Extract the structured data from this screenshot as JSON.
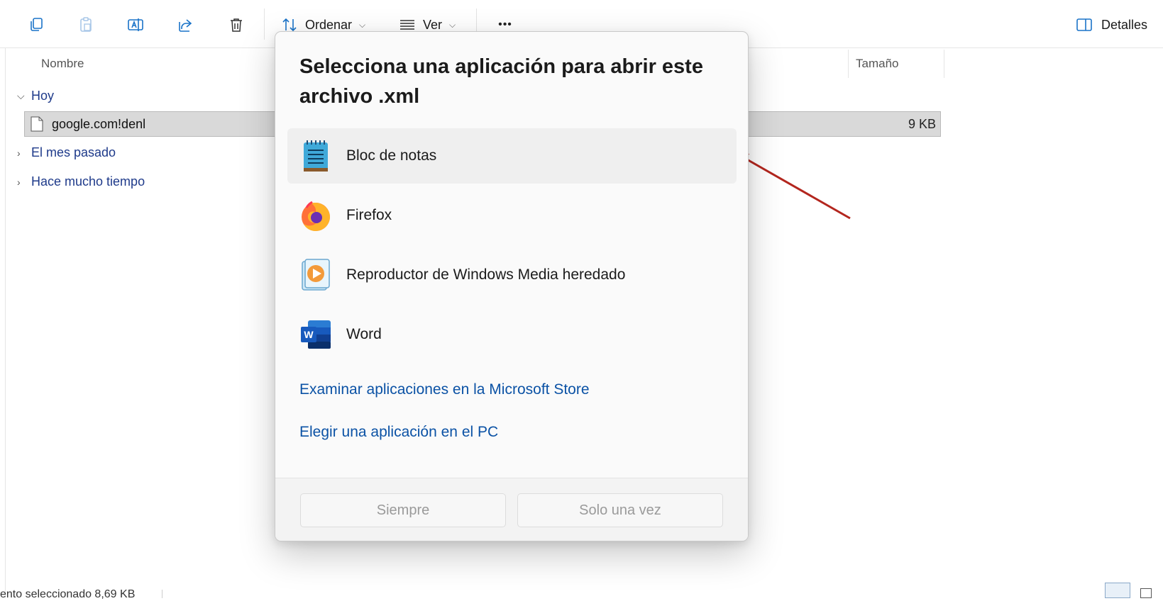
{
  "toolbar": {
    "sort_label": "Ordenar",
    "view_label": "Ver",
    "more_label": "•••",
    "details_label": "Detalles"
  },
  "columns": {
    "name": "Nombre",
    "size": "Tamaño"
  },
  "groups": {
    "today": "Hoy",
    "last_month": "El mes pasado",
    "long_ago": "Hace mucho tiempo"
  },
  "file": {
    "name": "google.com!denl",
    "size": "9 KB"
  },
  "status": {
    "text": "ento seleccionado 8,69 KB"
  },
  "dialog": {
    "title_line1": "Selecciona una aplicación para abrir este",
    "title_line2": "archivo .xml",
    "apps": [
      {
        "label": "Bloc de notas",
        "icon": "notepad-icon"
      },
      {
        "label": "Firefox",
        "icon": "firefox-icon"
      },
      {
        "label": "Reproductor de Windows Media heredado",
        "icon": "windows-media-player-icon"
      },
      {
        "label": "Word",
        "icon": "word-icon"
      }
    ],
    "link_store": "Examinar aplicaciones en la Microsoft Store",
    "link_pc": "Elegir una aplicación en el PC",
    "btn_always": "Siempre",
    "btn_once": "Solo una vez"
  },
  "colors": {
    "link": "#0b52a5",
    "accent": "#1a73c8",
    "annotation_arrow": "#b3261e",
    "selected_row": "#d9d9d9"
  }
}
